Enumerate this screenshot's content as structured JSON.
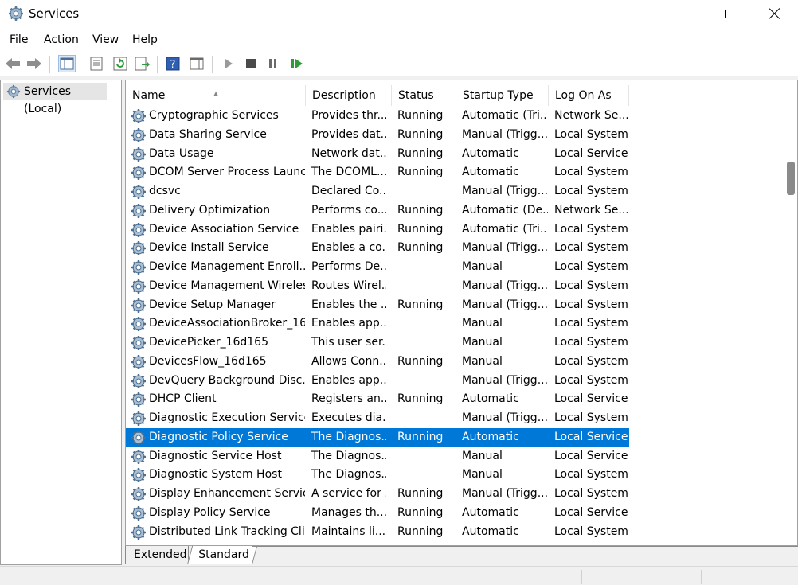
{
  "window": {
    "title": "Services"
  },
  "menu": {
    "items": [
      "File",
      "Action",
      "View",
      "Help"
    ]
  },
  "toolbar": {
    "icons": [
      "back-arrow-icon",
      "forward-arrow-icon",
      "show-hide-console-tree-icon",
      "properties-icon",
      "refresh-icon",
      "export-list-icon",
      "help-icon",
      "show-hide-action-pane-icon",
      "start-service-icon",
      "stop-service-icon",
      "pause-service-icon",
      "restart-service-icon"
    ]
  },
  "tree": {
    "root_label": "Services (Local)"
  },
  "list": {
    "columns": {
      "name": "Name",
      "description": "Description",
      "status": "Status",
      "startup": "Startup Type",
      "logon": "Log On As"
    },
    "selected_index": 17,
    "rows": [
      {
        "name": "Cryptographic Services",
        "description": "Provides thr...",
        "status": "Running",
        "startup": "Automatic (Tri...",
        "logon": "Network Se..."
      },
      {
        "name": "Data Sharing Service",
        "description": "Provides dat...",
        "status": "Running",
        "startup": "Manual (Trigg...",
        "logon": "Local System"
      },
      {
        "name": "Data Usage",
        "description": "Network dat...",
        "status": "Running",
        "startup": "Automatic",
        "logon": "Local Service"
      },
      {
        "name": "DCOM Server Process Launc...",
        "description": "The DCOML...",
        "status": "Running",
        "startup": "Automatic",
        "logon": "Local System"
      },
      {
        "name": "dcsvc",
        "description": "Declared Co...",
        "status": "",
        "startup": "Manual (Trigg...",
        "logon": "Local System"
      },
      {
        "name": "Delivery Optimization",
        "description": "Performs co...",
        "status": "Running",
        "startup": "Automatic (De...",
        "logon": "Network Se..."
      },
      {
        "name": "Device Association Service",
        "description": "Enables pairi...",
        "status": "Running",
        "startup": "Automatic (Tri...",
        "logon": "Local System"
      },
      {
        "name": "Device Install Service",
        "description": "Enables a co...",
        "status": "Running",
        "startup": "Manual (Trigg...",
        "logon": "Local System"
      },
      {
        "name": "Device Management Enroll...",
        "description": "Performs De...",
        "status": "",
        "startup": "Manual",
        "logon": "Local System"
      },
      {
        "name": "Device Management Wireles...",
        "description": "Routes Wirel...",
        "status": "",
        "startup": "Manual (Trigg...",
        "logon": "Local System"
      },
      {
        "name": "Device Setup Manager",
        "description": "Enables the ...",
        "status": "Running",
        "startup": "Manual (Trigg...",
        "logon": "Local System"
      },
      {
        "name": "DeviceAssociationBroker_16...",
        "description": "Enables app...",
        "status": "",
        "startup": "Manual",
        "logon": "Local System"
      },
      {
        "name": "DevicePicker_16d165",
        "description": "This user ser...",
        "status": "",
        "startup": "Manual",
        "logon": "Local System"
      },
      {
        "name": "DevicesFlow_16d165",
        "description": "Allows Conn...",
        "status": "Running",
        "startup": "Manual",
        "logon": "Local System"
      },
      {
        "name": "DevQuery Background Disc...",
        "description": "Enables app...",
        "status": "",
        "startup": "Manual (Trigg...",
        "logon": "Local System"
      },
      {
        "name": "DHCP Client",
        "description": "Registers an...",
        "status": "Running",
        "startup": "Automatic",
        "logon": "Local Service"
      },
      {
        "name": "Diagnostic Execution Service",
        "description": "Executes dia...",
        "status": "",
        "startup": "Manual (Trigg...",
        "logon": "Local System"
      },
      {
        "name": "Diagnostic Policy Service",
        "description": "The Diagnos...",
        "status": "Running",
        "startup": "Automatic",
        "logon": "Local Service"
      },
      {
        "name": "Diagnostic Service Host",
        "description": "The Diagnos...",
        "status": "",
        "startup": "Manual",
        "logon": "Local Service"
      },
      {
        "name": "Diagnostic System Host",
        "description": "The Diagnos...",
        "status": "",
        "startup": "Manual",
        "logon": "Local System"
      },
      {
        "name": "Display Enhancement Service",
        "description": "A service for ...",
        "status": "Running",
        "startup": "Manual (Trigg...",
        "logon": "Local System"
      },
      {
        "name": "Display Policy Service",
        "description": "Manages th...",
        "status": "Running",
        "startup": "Automatic",
        "logon": "Local Service"
      },
      {
        "name": "Distributed Link Tracking Cli...",
        "description": "Maintains li...",
        "status": "Running",
        "startup": "Automatic",
        "logon": "Local System"
      }
    ]
  },
  "tabs": {
    "extended": "Extended",
    "standard": "Standard"
  },
  "colors": {
    "selection": "#0078d7"
  }
}
